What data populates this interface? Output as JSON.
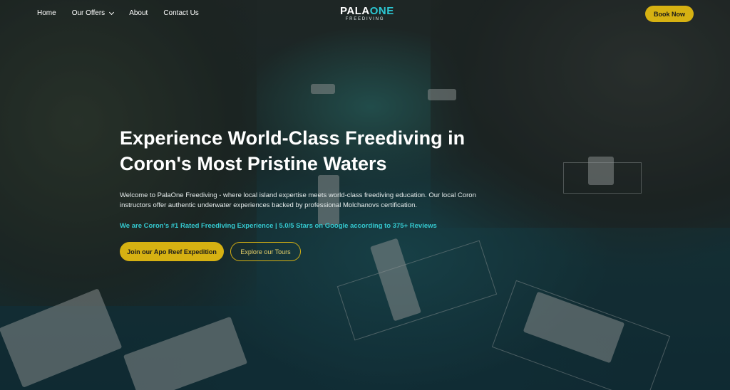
{
  "nav": {
    "items": [
      {
        "label": "Home"
      },
      {
        "label": "Our Offers"
      },
      {
        "label": "About"
      },
      {
        "label": "Contact Us"
      }
    ],
    "book_label": "Book Now"
  },
  "logo": {
    "main_a": "PALA",
    "main_b": "ONE",
    "sub": "FREEDIVING"
  },
  "hero": {
    "title": "Experience World-Class Freediving in Coron's Most Pristine Waters",
    "description": "Welcome to PalaOne Freediving - where local island expertise meets world-class freediving education. Our local Coron instructors offer authentic underwater experiences backed by professional Molchanovs certification.",
    "rating": "We are Coron's #1 Rated Freediving Experience | 5.0/5 Stars on Google according to 375+ Reviews",
    "cta_primary": "Join our Apo Reef Expedition",
    "cta_secondary": "Explore our Tours"
  },
  "colors": {
    "accent_gold": "#d6b112",
    "accent_teal": "#2cc7d3"
  }
}
